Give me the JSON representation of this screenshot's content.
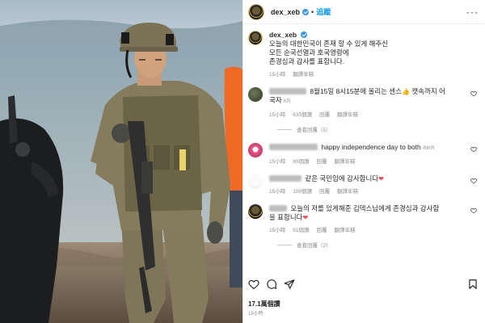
{
  "post": {
    "username": "dex_xeb",
    "follow_label": "追蹤",
    "more_icon": "more-horizontal-icon",
    "caption_username": "dex_xeb",
    "caption_lines": [
      "오늘의 대한민국이 존재 할 수 있게 해주신",
      "모든 순국선열과 호국영령에",
      "존경심과 감사를 표합니다."
    ],
    "caption_time": "15小時",
    "caption_translate": "翻譯年糕"
  },
  "comments": [
    {
      "text": "8월15일 8시15분에 올리는 센스",
      "emoji": "👍",
      "text_tail": "캣속까지 어",
      "text_line2": "국자",
      "suffix": "KR",
      "time": "15小時",
      "likes": "635個讚",
      "reply": "回覆",
      "translate": "翻譯年糕",
      "view_replies": "查看回覆（5）"
    },
    {
      "text": "happy independence day to both",
      "suffix": "INKR",
      "time": "15小時",
      "likes": "85個讚",
      "reply": "回覆",
      "translate": "翻譯年糕"
    },
    {
      "text": "같은 국민임에 감사합니다",
      "time": "15小時",
      "likes": "199個讚",
      "reply": "回覆",
      "translate": "翻譯年糕"
    },
    {
      "text": "오늘의 저를 있게해준 김덱스님에게 존경심과 감사함",
      "text_line2": "을 표합니다",
      "time": "15小時",
      "likes": "91個讚",
      "reply": "回覆",
      "translate": "翻譯年糕",
      "view_replies": "查看回覆（2）"
    }
  ],
  "footer": {
    "likes": "17.1萬個讚",
    "time": "15小時"
  },
  "icons": [
    "heart-icon",
    "comment-icon",
    "share-icon",
    "bookmark-icon"
  ],
  "colors": {
    "link": "#0095f6",
    "verified": "#3897f0",
    "heart_red": "#ed4956",
    "meta": "#8e8e8e"
  }
}
